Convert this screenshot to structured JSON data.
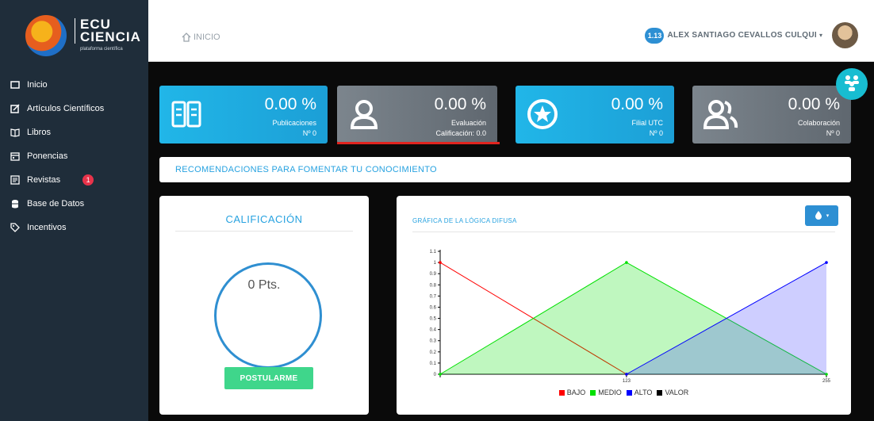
{
  "brand": {
    "line1": "ECU",
    "line2": "CIENCIA",
    "sub": "plataforma científica"
  },
  "sidebar": {
    "items": [
      {
        "label": "Inicio",
        "icon": "square-icon"
      },
      {
        "label": "Artículos Científicos",
        "icon": "edit-icon"
      },
      {
        "label": "Libros",
        "icon": "book-open-icon"
      },
      {
        "label": "Ponencias",
        "icon": "calendar-icon"
      },
      {
        "label": "Revistas",
        "icon": "newspaper-icon",
        "badge": "1"
      },
      {
        "label": "Base de Datos",
        "icon": "database-icon"
      },
      {
        "label": "Incentivos",
        "icon": "tag-icon"
      }
    ]
  },
  "topbar": {
    "breadcrumb": "INICIO",
    "user_badge": "1.13",
    "user_name": "ALEX SANTIAGO CEVALLOS CULQUI",
    "caret": "▾"
  },
  "stats": [
    {
      "value": "0.00 %",
      "label": "Publicaciones",
      "sub": "Nº 0",
      "icon": "book-icon",
      "color": "#21b6e8"
    },
    {
      "value": "0.00 %",
      "label": "Evaluación",
      "sub": "Calificación: 0.0",
      "icon": "user-icon",
      "color": "#6f777f"
    },
    {
      "value": "0.00 %",
      "label": "Filial UTC",
      "sub": "Nº 0",
      "icon": "star-circle-icon",
      "color": "#21b6e8"
    },
    {
      "value": "0.00 %",
      "label": "Colaboración",
      "sub": "Nº 0",
      "icon": "users-icon",
      "color": "#6f777f"
    }
  ],
  "recommendations": "RECOMENDACIONES PARA FOMENTAR TU CONOCIMIENTO",
  "calificacion": {
    "title": "CALIFICACIÓN",
    "points": "0 Pts.",
    "button": "POSTULARME"
  },
  "chart_card": {
    "title": "GRÁFICA DE LA LÓGICA DIFUSA",
    "dropdown_icon": "drop-icon"
  },
  "chart_data": {
    "type": "area",
    "x_ticks": [
      "123",
      "255"
    ],
    "y_ticks": [
      "0",
      "0.1",
      "0.2",
      "0.3",
      "0.4",
      "0.5",
      "0.6",
      "0.7",
      "0.8",
      "0.9",
      "1",
      "1.1"
    ],
    "xlim": [
      0,
      255
    ],
    "ylim": [
      0,
      1.1
    ],
    "series": [
      {
        "name": "BAJO",
        "color": "#ff0000",
        "points": [
          [
            0,
            1
          ],
          [
            123,
            0
          ]
        ]
      },
      {
        "name": "MEDIO",
        "color": "#00e000",
        "points": [
          [
            0,
            0
          ],
          [
            123,
            1
          ],
          [
            255,
            0
          ]
        ]
      },
      {
        "name": "ALTO",
        "color": "#0000ff",
        "points": [
          [
            123,
            0
          ],
          [
            255,
            1
          ]
        ]
      },
      {
        "name": "VALOR",
        "color": "#000000",
        "points": [
          [
            0,
            0
          ]
        ]
      }
    ]
  }
}
